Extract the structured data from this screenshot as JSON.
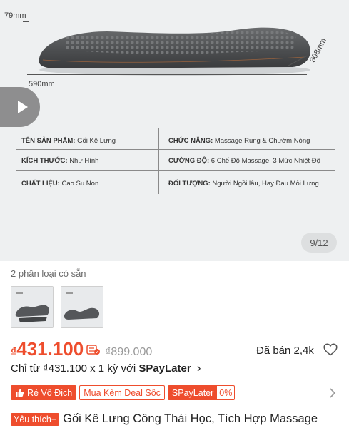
{
  "hero": {
    "dim_height": "79mm",
    "dim_width": "590mm",
    "dim_depth": "308mm",
    "counter": "9/12",
    "specs": [
      {
        "left_key": "TÊN SẢN PHẨM:",
        "left_val": "Gối Kê Lưng",
        "right_key": "CHỨC NĂNG:",
        "right_val": "Massage Rung & Chườm Nóng"
      },
      {
        "left_key": "KÍCH THƯỚC:",
        "left_val": "Như Hình",
        "right_key": "CƯỜNG ĐỘ:",
        "right_val": "6 Chế Độ Massage, 3 Mức Nhiệt Độ"
      },
      {
        "left_key": "CHẤT LIỆU:",
        "left_val": "Cao Su Non",
        "right_key": "ĐỐI TƯỢNG:",
        "right_val": "Người Ngồi lâu, Hay Đau Mỏi Lưng"
      }
    ]
  },
  "variants": {
    "label": "2 phân loại có sẵn"
  },
  "price": {
    "currency": "₫",
    "value": "431.100",
    "original": "₫899.000",
    "sold": "Đã bán 2,4k"
  },
  "installment": {
    "text": "Chỉ từ ₫431.100 x 1 kỳ với ",
    "brand": "SPayLater",
    "arrow": "›"
  },
  "badges": {
    "cheap": "Rẻ Vô Địch",
    "deal": "Mua Kèm Deal Sốc",
    "spay_label": "SPayLater",
    "spay_rate": "0%"
  },
  "product": {
    "fav_tag": "Yêu thích+",
    "title": "Gối Kê Lưng Công Thái Học, Tích Hợp Massage"
  },
  "colors": {
    "accent": "#ee4d2d",
    "hero_bg": "#eef0f1"
  }
}
